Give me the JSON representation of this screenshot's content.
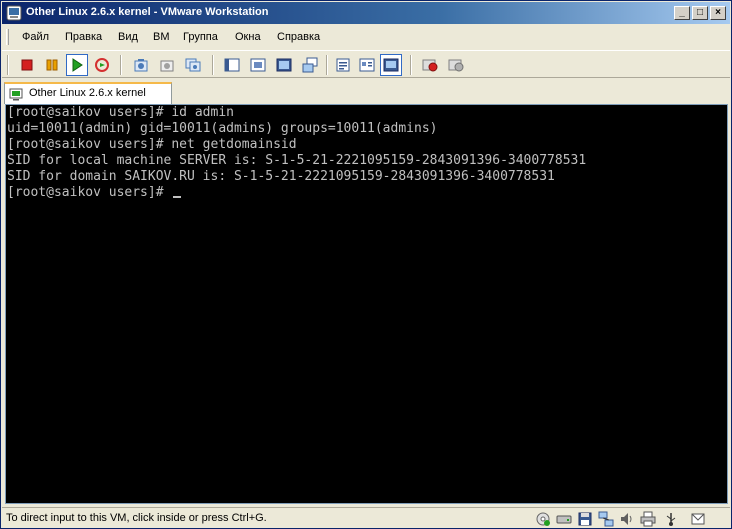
{
  "window": {
    "title": "Other Linux 2.6.x kernel - VMware Workstation",
    "minimize_glyph": "_",
    "maximize_glyph": "□",
    "close_glyph": "×"
  },
  "menu": {
    "items": [
      "Файл",
      "Правка",
      "Вид",
      "ВМ",
      "Группа",
      "Окна",
      "Справка"
    ]
  },
  "toolbar": {
    "buttons": [
      {
        "name": "power-off-icon",
        "color": "#d42020"
      },
      {
        "name": "suspend-icon",
        "color": "#e8a000"
      },
      {
        "name": "power-on-icon",
        "color": "#22a022"
      },
      {
        "name": "reset-icon",
        "color": "#d43030"
      },
      {
        "name": "snapshot-icon",
        "color": "#4a7ab8"
      },
      {
        "name": "revert-snapshot-icon",
        "color": "#808080"
      },
      {
        "name": "snapshot-manager-icon",
        "color": "#4a7ab8"
      },
      {
        "name": "sidebar-icon",
        "color": "#3a5a90"
      },
      {
        "name": "fit-window-icon",
        "color": "#3a5a90"
      },
      {
        "name": "full-screen-icon",
        "color": "#3a5a90"
      },
      {
        "name": "quick-switch-icon",
        "color": "#3a5a90"
      },
      {
        "name": "summary-icon",
        "color": "#3a5a90"
      },
      {
        "name": "appliance-view-icon",
        "color": "#3a5a90"
      },
      {
        "name": "console-view-icon",
        "color": "#3a5a90"
      },
      {
        "name": "record-icon",
        "color": "#d42020"
      },
      {
        "name": "playback-icon",
        "color": "#808080"
      }
    ]
  },
  "tab": {
    "label": "Other Linux 2.6.x kernel"
  },
  "console": {
    "lines": [
      "[root@saikov users]# id admin",
      "uid=10011(admin) gid=10011(admins) groups=10011(admins)",
      "[root@saikov users]# net getdomainsid",
      "SID for local machine SERVER is: S-1-5-21-2221095159-2843091396-3400778531",
      "SID for domain SAIKOV.RU is: S-1-5-21-2221095159-2843091396-3400778531",
      "[root@saikov users]# "
    ]
  },
  "status": {
    "text": "To direct input to this VM, click inside or press Ctrl+G.",
    "icons": [
      "cd-rom-icon",
      "hard-disk-icon",
      "floppy-icon",
      "network-icon",
      "sound-icon",
      "printer-icon",
      "usb-icon",
      "messages-icon"
    ]
  }
}
